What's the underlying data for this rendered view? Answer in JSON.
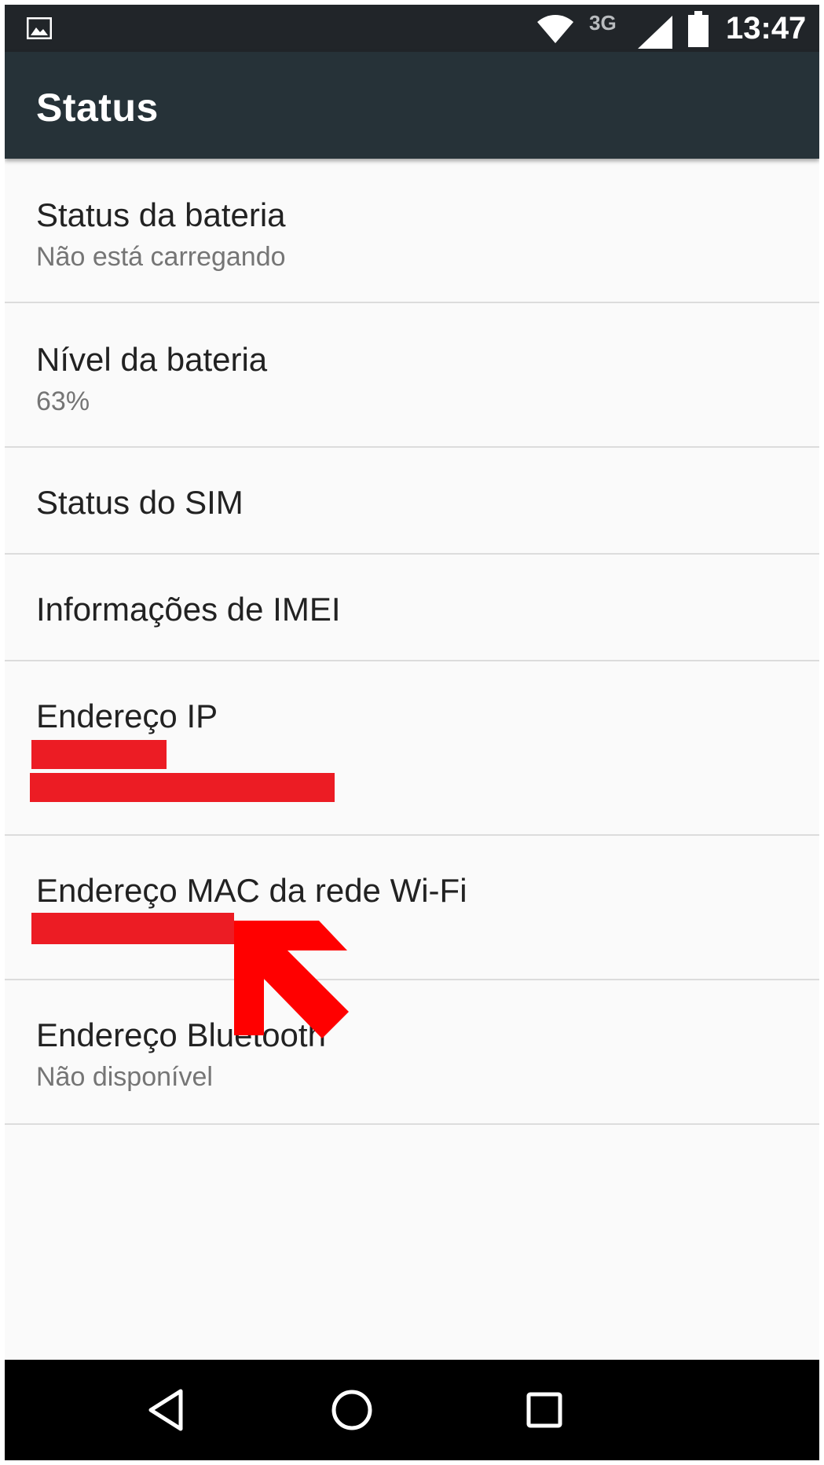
{
  "status_bar": {
    "network_type": "3G",
    "time": "13:47",
    "icons": [
      "image-notification-icon",
      "wifi-icon",
      "cell-signal-icon",
      "battery-icon"
    ]
  },
  "app_bar": {
    "title": "Status"
  },
  "items": [
    {
      "title": "Status da bateria",
      "subtitle": "Não está carregando"
    },
    {
      "title": "Nível da bateria",
      "subtitle": "63%"
    },
    {
      "title": "Status do SIM"
    },
    {
      "title": "Informações de IMEI"
    },
    {
      "title": "Endereço IP"
    },
    {
      "title": "Endereço MAC da rede Wi-Fi"
    },
    {
      "title": "Endereço Bluetooth",
      "subtitle": "Não disponível"
    }
  ],
  "nav_bar": {
    "icons": [
      "back-icon",
      "home-icon",
      "recents-icon"
    ]
  },
  "colors": {
    "status_bar": "#212529",
    "app_bar": "#263238",
    "background": "#fafafa",
    "redaction": "#ec1c24",
    "annotation_arrow": "#ff0000"
  }
}
